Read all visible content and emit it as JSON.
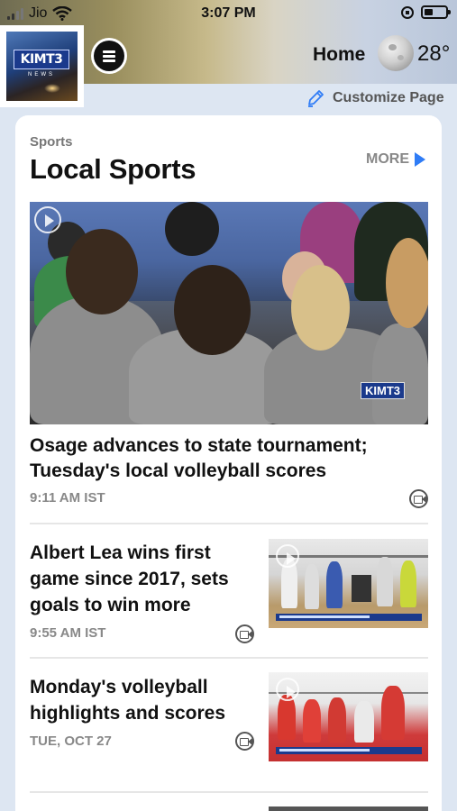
{
  "status_bar": {
    "carrier": "Jio",
    "time": "3:07 PM"
  },
  "header": {
    "logo_text": "KIMT3",
    "logo_subtext": "NEWS",
    "page_label": "Home",
    "weather_icon": "moon-icon",
    "temperature": "28°"
  },
  "customize": {
    "label": "Customize Page"
  },
  "section": {
    "kicker": "Sports",
    "title": "Local Sports",
    "more_label": "MORE"
  },
  "hero_story": {
    "headline": "Osage advances to state tournament; Tuesday's local volleyball scores",
    "time": "9:11 AM IST",
    "watermark": "KIMT3",
    "has_video": true
  },
  "stories": [
    {
      "headline": "Albert Lea wins first game since 2017, sets goals to win more",
      "time": "9:55 AM IST",
      "has_video": true
    },
    {
      "headline": "Monday's volleyball highlights and scores",
      "time": "TUE, OCT 27",
      "has_video": true
    }
  ],
  "colors": {
    "accent": "#2f7cf6",
    "card_bg": "#ffffff",
    "page_bg": "#dde6f2",
    "meta_text": "#888888"
  }
}
